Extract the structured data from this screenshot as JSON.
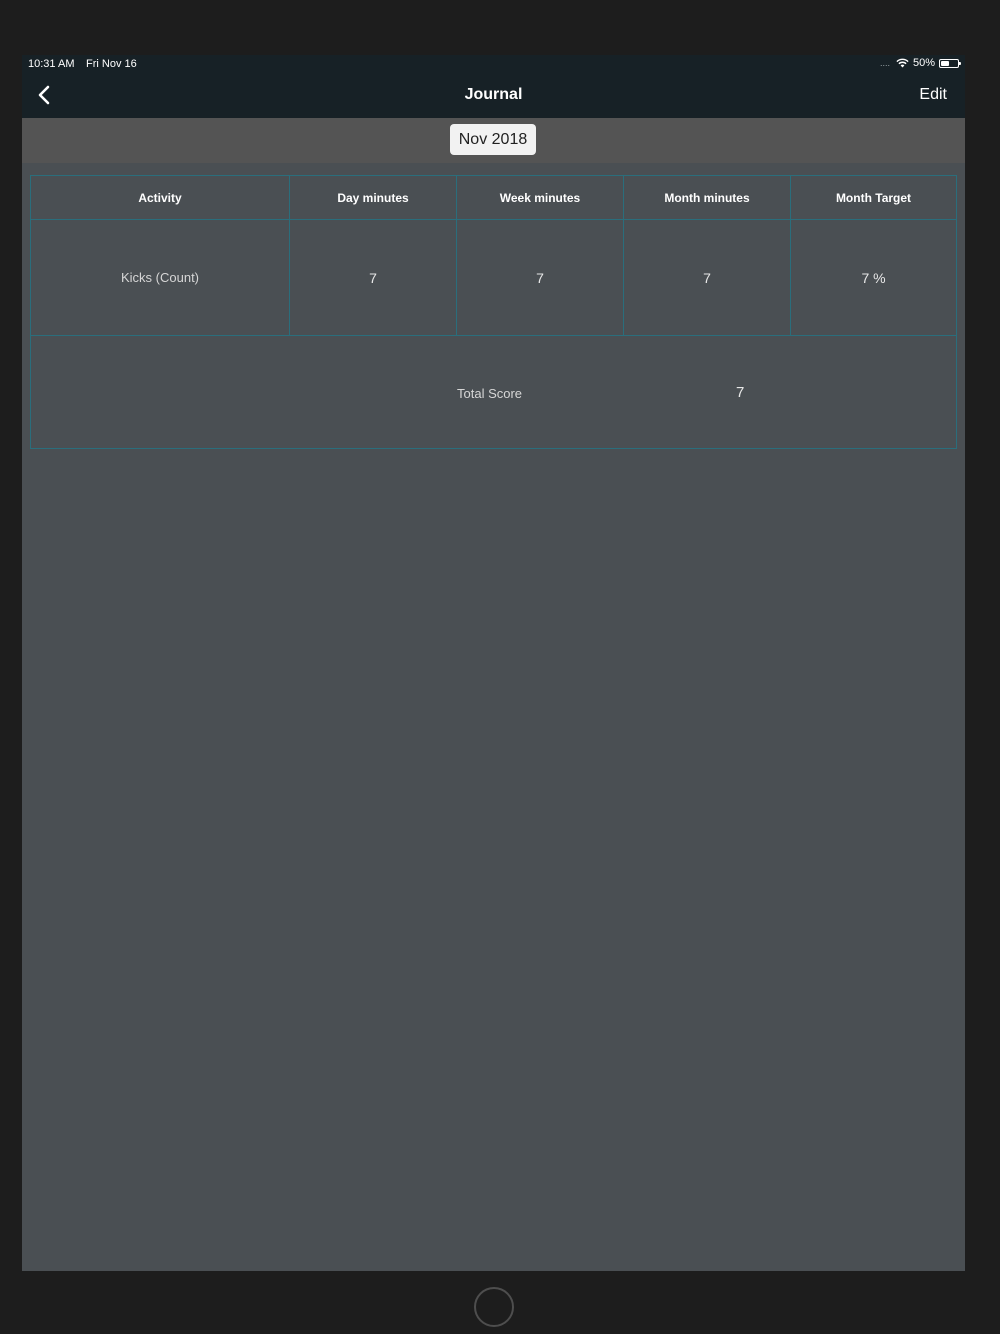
{
  "status_bar": {
    "time": "10:31 AM",
    "date": "Fri Nov 16",
    "signal_dots": "....",
    "battery_percent_label": "50%",
    "battery_level": 0.5,
    "wifi_icon": "wifi-icon",
    "battery_icon": "battery-icon"
  },
  "nav": {
    "title": "Journal",
    "edit_label": "Edit",
    "back_icon": "chevron-left-icon"
  },
  "month_selector": {
    "value": "Nov 2018"
  },
  "table": {
    "headers": [
      "Activity",
      "Day minutes",
      "Week minutes",
      "Month minutes",
      "Month Target"
    ],
    "rows": [
      {
        "activity": "Kicks (Count)",
        "day_minutes": "7",
        "week_minutes": "7",
        "month_minutes": "7",
        "month_target": "7 %"
      }
    ],
    "total_label": "Total Score",
    "total_value": "7"
  },
  "colors": {
    "nav_background": "#172126",
    "content_background": "#4a4f53",
    "table_border": "#2a6e7c",
    "month_bar_background": "#545454"
  }
}
